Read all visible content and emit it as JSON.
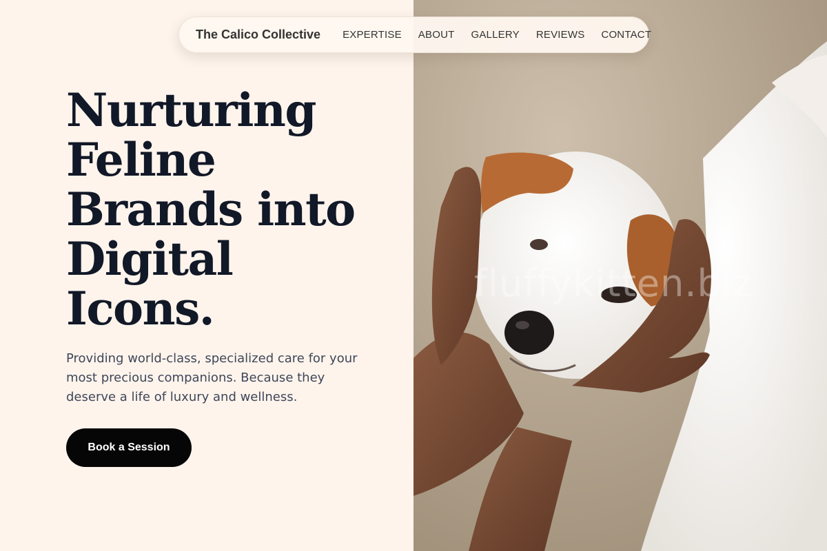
{
  "nav": {
    "brand": "The Calico Collective",
    "links": [
      "EXPERTISE",
      "ABOUT",
      "GALLERY",
      "REVIEWS",
      "CONTACT"
    ]
  },
  "hero": {
    "title_lines": [
      "Nurturing",
      "Feline",
      "Brands into",
      "Digital",
      "Icons."
    ],
    "description": "Providing world-class, specialized care for your most precious companions. Because they deserve a life of luxury and wellness.",
    "cta_label": "Book a Session"
  },
  "photo": {
    "subject": "white-puppy-held-in-hands",
    "watermark": "fluffykitten.biz"
  },
  "colors": {
    "background": "#fef4ec",
    "heading": "#111827",
    "body_text": "#3f4658",
    "button": "#060606",
    "button_text": "#ffffff"
  }
}
